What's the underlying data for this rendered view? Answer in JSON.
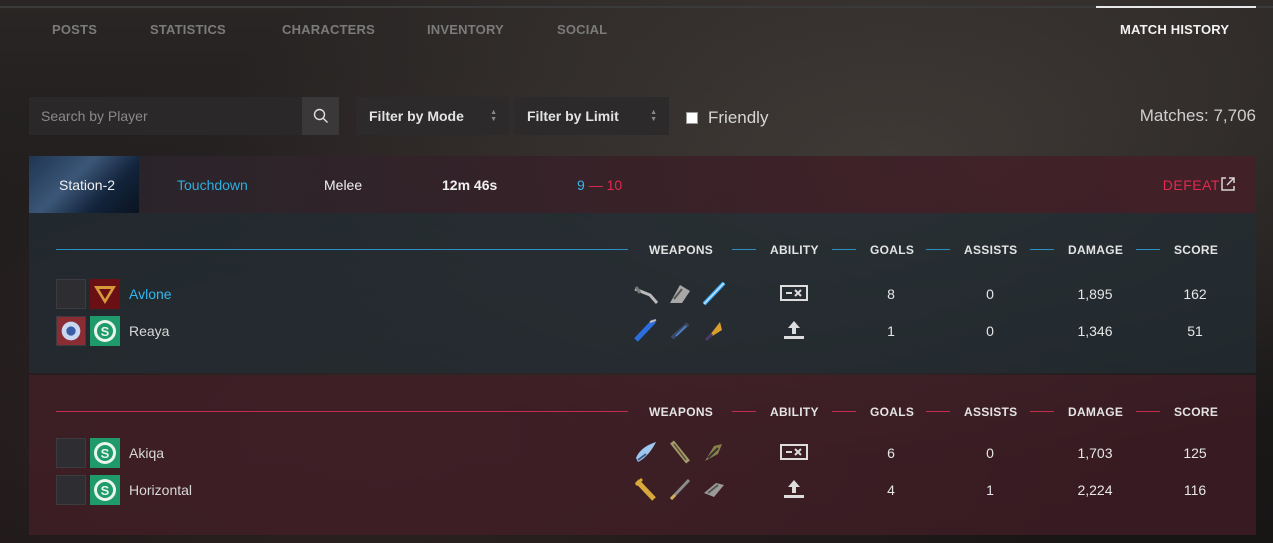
{
  "nav": {
    "tabs": [
      {
        "label": "POSTS"
      },
      {
        "label": "STATISTICS"
      },
      {
        "label": "CHARACTERS"
      },
      {
        "label": "INVENTORY"
      },
      {
        "label": "SOCIAL"
      },
      {
        "label": "MATCH HISTORY"
      }
    ],
    "active_tab": "MATCH HISTORY"
  },
  "filters": {
    "search_placeholder": "Search by Player",
    "mode_label": "Filter by Mode",
    "limit_label": "Filter by Limit",
    "friendly_label": "Friendly",
    "friendly_checked": false,
    "matches_label": "Matches: 7,706"
  },
  "match": {
    "map": "Station-2",
    "mode": "Touchdown",
    "type": "Melee",
    "duration": "12m 46s",
    "score_blue": "9",
    "score_sep": "—",
    "score_red": "10",
    "result": "DEFEAT"
  },
  "columns": {
    "weapons": "WEAPONS",
    "ability": "ABILITY",
    "goals": "GOALS",
    "assists": "ASSISTS",
    "damage": "DAMAGE",
    "score": "SCORE"
  },
  "teams": {
    "blue": {
      "players": [
        {
          "name": "Avlone",
          "goals": "8",
          "assists": "0",
          "damage": "1,895",
          "score": "162",
          "badge": "triangle-emblem-icon",
          "ability": "dash-ability-icon"
        },
        {
          "name": "Reaya",
          "goals": "1",
          "assists": "0",
          "damage": "1,346",
          "score": "51",
          "badge": "s-emblem-icon",
          "ability": "upload-ability-icon"
        }
      ]
    },
    "red": {
      "players": [
        {
          "name": "Akiqa",
          "goals": "6",
          "assists": "0",
          "damage": "1,703",
          "score": "125",
          "badge": "s-emblem-icon",
          "ability": "dash-ability-icon"
        },
        {
          "name": "Horizontal",
          "goals": "4",
          "assists": "1",
          "damage": "2,224",
          "score": "116",
          "badge": "s-emblem-icon",
          "ability": "upload-ability-icon"
        }
      ]
    }
  },
  "colors": {
    "blue": "#34b6ee",
    "red": "#e2294f"
  }
}
